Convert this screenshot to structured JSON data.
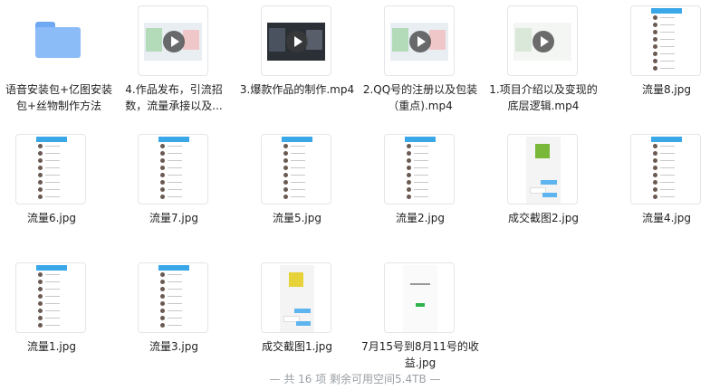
{
  "files": [
    {
      "name": "语音安装包+亿图安装包+丝物制作方法",
      "type": "folder"
    },
    {
      "name": "4.作品发布，引流招数，流量承接以及...",
      "type": "video"
    },
    {
      "name": "3.爆款作品的制作.mp4",
      "type": "video-dark"
    },
    {
      "name": "2.QQ号的注册以及包装（重点).mp4",
      "type": "video"
    },
    {
      "name": "1.项目介绍以及变现的底层逻辑.mp4",
      "type": "video"
    },
    {
      "name": "流量8.jpg",
      "type": "phone-list"
    },
    {
      "name": "流量6.jpg",
      "type": "phone-list"
    },
    {
      "name": "流量7.jpg",
      "type": "phone-list"
    },
    {
      "name": "流量5.jpg",
      "type": "phone-list"
    },
    {
      "name": "流量2.jpg",
      "type": "phone-list"
    },
    {
      "name": "成交截图2.jpg",
      "type": "chat"
    },
    {
      "name": "流量4.jpg",
      "type": "phone-list"
    },
    {
      "name": "流量1.jpg",
      "type": "phone-list"
    },
    {
      "name": "流量3.jpg",
      "type": "phone-list"
    },
    {
      "name": "成交截图1.jpg",
      "type": "chat"
    },
    {
      "name": "7月15号到8月11号的收益.jpg",
      "type": "receipt"
    }
  ],
  "footer": "— 共 16 项 剩余可用空间5.4TB —"
}
